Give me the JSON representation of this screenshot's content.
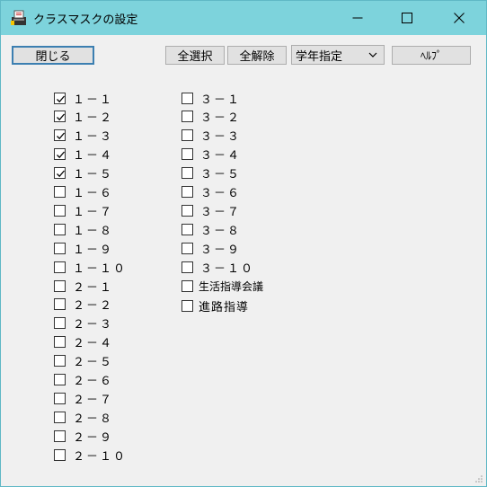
{
  "window": {
    "title": "クラスマスクの設定",
    "controls": {
      "minimize_icon": "minimize-icon",
      "maximize_icon": "maximize-icon",
      "close_icon": "close-icon"
    }
  },
  "toolbar": {
    "close_label": "閉じる",
    "select_all_label": "全選択",
    "deselect_all_label": "全解除",
    "grade_select_value": "学年指定",
    "help_label": "ﾍﾙﾌﾟ"
  },
  "classes_left": [
    {
      "label": "１－１",
      "checked": true
    },
    {
      "label": "１－２",
      "checked": true
    },
    {
      "label": "１－３",
      "checked": true
    },
    {
      "label": "１－４",
      "checked": true
    },
    {
      "label": "１－５",
      "checked": true
    },
    {
      "label": "１－６",
      "checked": false
    },
    {
      "label": "１－７",
      "checked": false
    },
    {
      "label": "１－８",
      "checked": false
    },
    {
      "label": "１－９",
      "checked": false
    },
    {
      "label": "１－１０",
      "checked": false
    },
    {
      "label": "２－１",
      "checked": false
    },
    {
      "label": "２－２",
      "checked": false
    },
    {
      "label": "２－３",
      "checked": false
    },
    {
      "label": "２－４",
      "checked": false
    },
    {
      "label": "２－５",
      "checked": false
    },
    {
      "label": "２－６",
      "checked": false
    },
    {
      "label": "２－７",
      "checked": false
    },
    {
      "label": "２－８",
      "checked": false
    },
    {
      "label": "２－９",
      "checked": false
    },
    {
      "label": "２－１０",
      "checked": false
    }
  ],
  "classes_right": [
    {
      "label": "３－１",
      "checked": false
    },
    {
      "label": "３－２",
      "checked": false
    },
    {
      "label": "３－３",
      "checked": false
    },
    {
      "label": "３－４",
      "checked": false
    },
    {
      "label": "３－５",
      "checked": false
    },
    {
      "label": "３－６",
      "checked": false
    },
    {
      "label": "３－７",
      "checked": false
    },
    {
      "label": "３－８",
      "checked": false
    },
    {
      "label": "３－９",
      "checked": false
    },
    {
      "label": "３－１０",
      "checked": false
    },
    {
      "label": "生活指導会議",
      "checked": false
    },
    {
      "label": "進路指導",
      "checked": false
    }
  ]
}
